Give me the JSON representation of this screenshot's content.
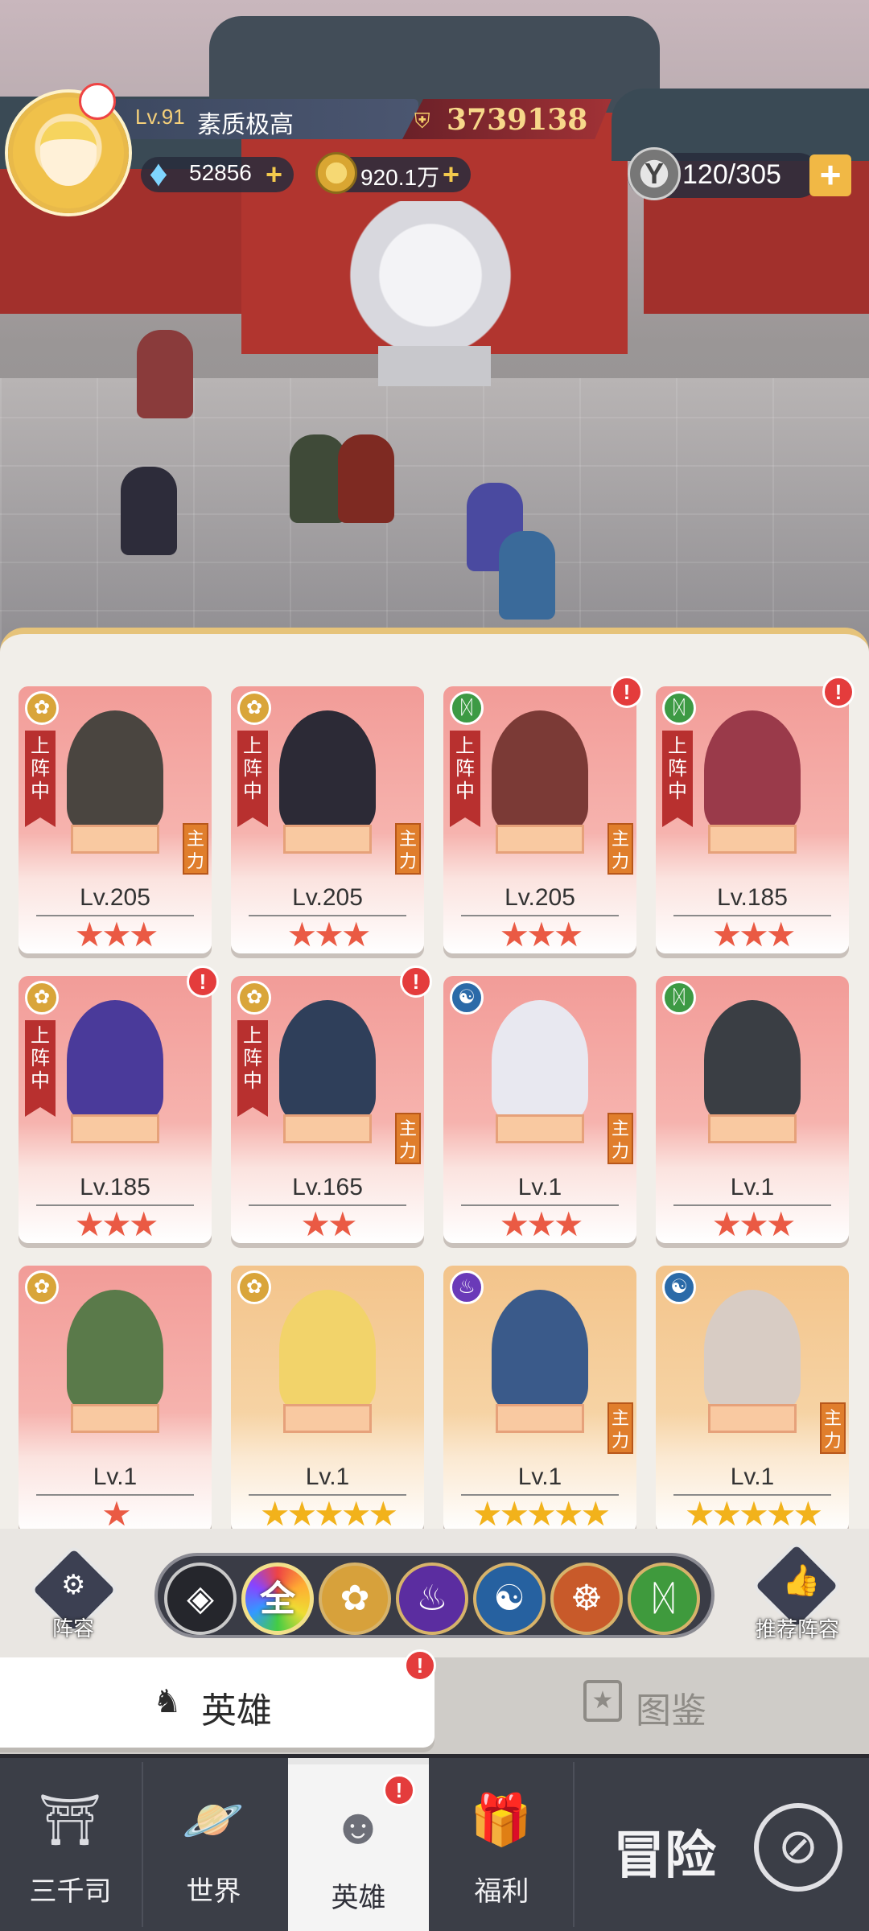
{
  "hud": {
    "level": "Lv.91",
    "player_name": "素质极高",
    "power": "3739138",
    "gems": "52856",
    "gold": "920.1万",
    "stamina": "120/305",
    "plus_symbol": "+"
  },
  "cards": [
    {
      "level": "Lv.205",
      "stars": "★★★",
      "star_color": "red",
      "deployed": "上阵中",
      "main": "主力",
      "faction": "lotus-icon"
    },
    {
      "level": "Lv.205",
      "stars": "★★★",
      "star_color": "red",
      "deployed": "上阵中",
      "main": "主力",
      "faction": "lotus-icon"
    },
    {
      "level": "Lv.205",
      "stars": "★★★",
      "star_color": "red",
      "deployed": "上阵中",
      "main": "主力",
      "faction": "dna-icon",
      "alert": "!"
    },
    {
      "level": "Lv.185",
      "stars": "★★★",
      "star_color": "red",
      "deployed": "上阵中",
      "faction": "dna-icon",
      "alert": "!"
    },
    {
      "level": "Lv.185",
      "stars": "★★★",
      "star_color": "red",
      "deployed": "上阵中",
      "faction": "lotus-icon",
      "alert": "!"
    },
    {
      "level": "Lv.165",
      "stars": "★★",
      "star_color": "red",
      "deployed": "上阵中",
      "main": "主力",
      "faction": "lotus-icon",
      "alert": "!"
    },
    {
      "level": "Lv.1",
      "stars": "★★★",
      "star_color": "red",
      "main": "主力",
      "faction": "yinyang-icon"
    },
    {
      "level": "Lv.1",
      "stars": "★★★",
      "star_color": "red",
      "faction": "dna-icon"
    },
    {
      "level": "Lv.1",
      "stars": "★",
      "star_color": "red",
      "faction": "lotus-icon"
    },
    {
      "level": "Lv.1",
      "stars": "★★★★★",
      "star_color": "gold",
      "faction": "lotus-icon"
    },
    {
      "level": "Lv.1",
      "stars": "★★★★★",
      "star_color": "gold",
      "main": "主力",
      "faction": "flame-icon"
    },
    {
      "level": "Lv.1",
      "stars": "★★★★★",
      "star_color": "gold",
      "main": "主力",
      "faction": "yinyang-icon"
    }
  ],
  "filter": {
    "lineup_label": "阵容",
    "all_label": "全",
    "recommend_label": "推荐阵容"
  },
  "tabs": {
    "heroes": "英雄",
    "codex": "图鉴",
    "alert": "!"
  },
  "nav": {
    "sanqiansi": "三千司",
    "world": "世界",
    "heroes": "英雄",
    "welfare": "福利",
    "adventure": "冒险",
    "alert": "!"
  },
  "colors": {
    "accent_gold": "#e6c37a",
    "card_red": "#f29c98",
    "card_gold": "#f3c48b",
    "alert_red": "#e43c3c",
    "nav_bg": "#3b3e47"
  }
}
